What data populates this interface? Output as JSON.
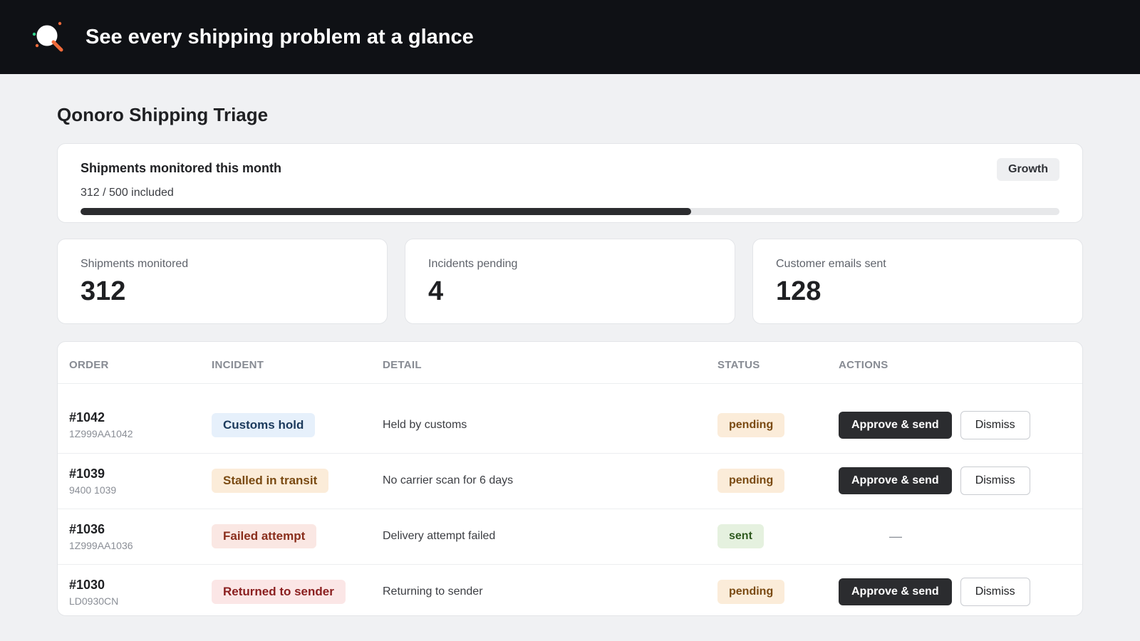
{
  "header": {
    "title": "See every shipping problem at a glance",
    "logo_icon": "magnifier-logo-icon"
  },
  "page": {
    "title": "Qonoro Shipping Triage"
  },
  "usage": {
    "title": "Shipments monitored this month",
    "count_text": "312 / 500 included",
    "used": 312,
    "included": 500,
    "plan_badge": "Growth"
  },
  "stats": [
    {
      "label": "Shipments monitored",
      "value": "312"
    },
    {
      "label": "Incidents pending",
      "value": "4"
    },
    {
      "label": "Customer emails sent",
      "value": "128"
    }
  ],
  "table": {
    "columns": [
      "ORDER",
      "INCIDENT",
      "DETAIL",
      "STATUS",
      "ACTIONS"
    ],
    "approve_label": "Approve & send",
    "dismiss_label": "Dismiss",
    "no_action": "—",
    "rows": [
      {
        "order": "#1042",
        "tracking": "1Z999AA1042",
        "incident": "Customs hold",
        "incident_bg": "#e6f0fb",
        "incident_fg": "#1b3a5c",
        "detail": "Held by customs",
        "status": "pending",
        "status_bg": "#fbecd9",
        "status_fg": "#7a4a12",
        "has_actions": true
      },
      {
        "order": "#1039",
        "tracking": "9400 1039",
        "incident": "Stalled in transit",
        "incident_bg": "#fbecd9",
        "incident_fg": "#7a4a12",
        "detail": "No carrier scan for 6 days",
        "status": "pending",
        "status_bg": "#fbecd9",
        "status_fg": "#7a4a12",
        "has_actions": true
      },
      {
        "order": "#1036",
        "tracking": "1Z999AA1036",
        "incident": "Failed attempt",
        "incident_bg": "#fae7e3",
        "incident_fg": "#8a2e1c",
        "detail": "Delivery attempt failed",
        "status": "sent",
        "status_bg": "#e5f1df",
        "status_fg": "#2f5a1f",
        "has_actions": false
      },
      {
        "order": "#1030",
        "tracking": "LD0930CN",
        "incident": "Returned to sender",
        "incident_bg": "#fbe6e6",
        "incident_fg": "#8a1f1f",
        "detail": "Returning to sender",
        "status": "pending",
        "status_bg": "#fbecd9",
        "status_fg": "#7a4a12",
        "has_actions": true
      }
    ]
  }
}
